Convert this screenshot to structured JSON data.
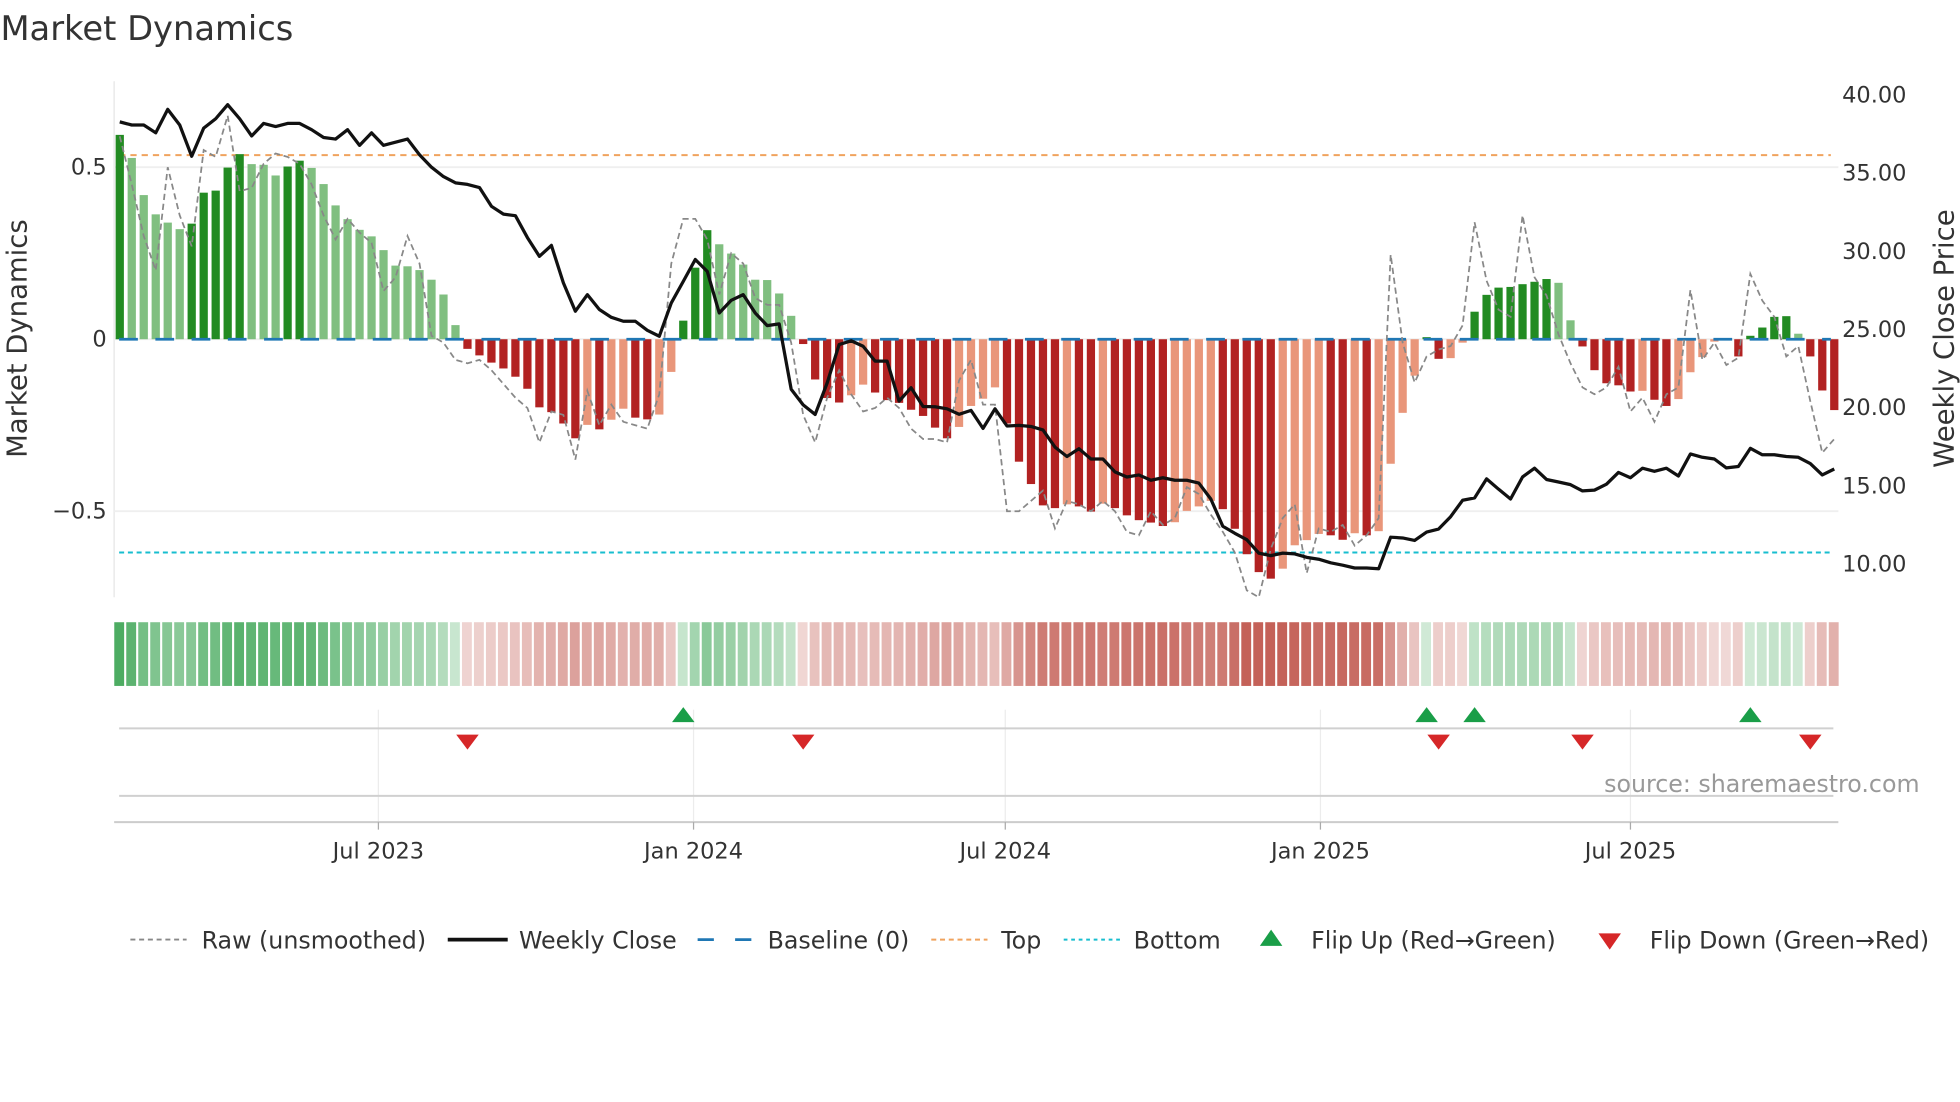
{
  "chart_data": {
    "type": "bar",
    "title": "Market Dynamics",
    "ylabel": "Market Dynamics",
    "y2label": "Weekly Close Price",
    "source": "source: sharemaestro.com",
    "ylim": [
      -0.75,
      0.75
    ],
    "y2lim": [
      7.8,
      40.8
    ],
    "start_date": "2023-01-31",
    "step_days": 7,
    "y_ticks": [
      {
        "value": 0.5,
        "label": "0.5"
      },
      {
        "value": 0,
        "label": "0"
      },
      {
        "value": -0.5,
        "label": "−0.5"
      }
    ],
    "y2_ticks": [
      {
        "value": 40,
        "label": "40.00"
      },
      {
        "value": 35,
        "label": "35.00"
      },
      {
        "value": 30,
        "label": "30.00"
      },
      {
        "value": 25,
        "label": "25.00"
      },
      {
        "value": 20,
        "label": "20.00"
      },
      {
        "value": 15,
        "label": "15.00"
      },
      {
        "value": 10,
        "label": "10.00"
      }
    ],
    "x_ticks": [
      {
        "date": "2023-07-01",
        "label": "Jul 2023"
      },
      {
        "date": "2024-01-01",
        "label": "Jan 2024"
      },
      {
        "date": "2024-07-01",
        "label": "Jul 2024"
      },
      {
        "date": "2025-01-01",
        "label": "Jan 2025"
      },
      {
        "date": "2025-07-01",
        "label": "Jul 2025"
      }
    ],
    "top_level": 0.535,
    "bottom_level": -0.62,
    "baseline": 0,
    "momentum": [
      0.594,
      0.527,
      0.419,
      0.363,
      0.339,
      0.32,
      0.336,
      0.426,
      0.432,
      0.499,
      0.538,
      0.509,
      0.507,
      0.476,
      0.502,
      0.519,
      0.498,
      0.451,
      0.389,
      0.349,
      0.318,
      0.299,
      0.259,
      0.214,
      0.212,
      0.201,
      0.173,
      0.13,
      0.041,
      -0.028,
      -0.047,
      -0.068,
      -0.085,
      -0.109,
      -0.144,
      -0.198,
      -0.212,
      -0.245,
      -0.288,
      -0.249,
      -0.262,
      -0.234,
      -0.202,
      -0.228,
      -0.233,
      -0.219,
      -0.095,
      0.054,
      0.208,
      0.317,
      0.276,
      0.249,
      0.217,
      0.173,
      0.172,
      0.133,
      0.068,
      -0.014,
      -0.117,
      -0.171,
      -0.184,
      -0.163,
      -0.132,
      -0.155,
      -0.177,
      -0.185,
      -0.205,
      -0.223,
      -0.257,
      -0.288,
      -0.255,
      -0.194,
      -0.173,
      -0.14,
      -0.245,
      -0.356,
      -0.421,
      -0.483,
      -0.491,
      -0.48,
      -0.486,
      -0.501,
      -0.478,
      -0.491,
      -0.512,
      -0.526,
      -0.533,
      -0.543,
      -0.532,
      -0.499,
      -0.486,
      -0.47,
      -0.494,
      -0.551,
      -0.625,
      -0.677,
      -0.696,
      -0.667,
      -0.599,
      -0.584,
      -0.566,
      -0.57,
      -0.583,
      -0.564,
      -0.57,
      -0.558,
      -0.362,
      -0.214,
      -0.106,
      0.006,
      -0.057,
      -0.055,
      -0.01,
      0.08,
      0.129,
      0.15,
      0.152,
      0.16,
      0.167,
      0.175,
      0.164,
      0.055,
      -0.021,
      -0.09,
      -0.128,
      -0.134,
      -0.152,
      -0.15,
      -0.176,
      -0.194,
      -0.174,
      -0.096,
      -0.052,
      -0.007,
      -0.002,
      -0.05,
      0.01,
      0.034,
      0.065,
      0.067,
      0.016,
      -0.05,
      -0.149,
      -0.206
    ],
    "raw": [
      0.59,
      0.45,
      0.3,
      0.2,
      0.5,
      0.36,
      0.27,
      0.55,
      0.53,
      0.65,
      0.43,
      0.44,
      0.51,
      0.54,
      0.53,
      0.51,
      0.45,
      0.36,
      0.29,
      0.35,
      0.31,
      0.28,
      0.14,
      0.18,
      0.3,
      0.22,
      0.01,
      -0.01,
      -0.06,
      -0.07,
      -0.06,
      -0.09,
      -0.13,
      -0.17,
      -0.2,
      -0.3,
      -0.21,
      -0.22,
      -0.35,
      -0.15,
      -0.25,
      -0.19,
      -0.24,
      -0.25,
      -0.26,
      -0.16,
      0.22,
      0.35,
      0.35,
      0.29,
      0.13,
      0.25,
      0.22,
      0.12,
      0.1,
      0.1,
      -0.01,
      -0.22,
      -0.3,
      -0.17,
      -0.09,
      -0.16,
      -0.21,
      -0.2,
      -0.17,
      -0.2,
      -0.26,
      -0.29,
      -0.29,
      -0.3,
      -0.12,
      -0.06,
      -0.19,
      -0.19,
      -0.5,
      -0.5,
      -0.47,
      -0.44,
      -0.55,
      -0.47,
      -0.48,
      -0.5,
      -0.47,
      -0.5,
      -0.56,
      -0.57,
      -0.5,
      -0.54,
      -0.52,
      -0.43,
      -0.45,
      -0.51,
      -0.56,
      -0.62,
      -0.73,
      -0.75,
      -0.61,
      -0.52,
      -0.48,
      -0.68,
      -0.55,
      -0.56,
      -0.54,
      -0.6,
      -0.57,
      -0.52,
      0.246,
      -0.01,
      -0.126,
      -0.05,
      -0.03,
      -0.02,
      0.04,
      0.34,
      0.17,
      0.086,
      0.065,
      0.36,
      0.18,
      0.127,
      0.014,
      -0.07,
      -0.14,
      -0.16,
      -0.14,
      -0.08,
      -0.21,
      -0.17,
      -0.24,
      -0.16,
      -0.14,
      0.143,
      -0.06,
      -0.01,
      -0.075,
      -0.054,
      0.19,
      0.112,
      0.065,
      -0.05,
      -0.02,
      -0.18,
      -0.33,
      -0.29
    ],
    "weekly_close": [
      38.2,
      38.0,
      38.0,
      37.5,
      39.0,
      38.0,
      36.0,
      37.8,
      38.4,
      39.3,
      38.4,
      37.3,
      38.1,
      37.9,
      38.1,
      38.1,
      37.7,
      37.2,
      37.1,
      37.7,
      36.7,
      37.5,
      36.7,
      36.9,
      37.1,
      36.1,
      35.3,
      34.7,
      34.3,
      34.2,
      34.0,
      32.8,
      32.3,
      32.2,
      30.8,
      29.6,
      30.3,
      27.9,
      26.09,
      27.15,
      26.2,
      25.7,
      25.45,
      25.45,
      24.87,
      24.49,
      26.62,
      28.0,
      29.4,
      28.64,
      25.98,
      26.79,
      27.15,
      25.98,
      25.17,
      25.28,
      21.1,
      20.1,
      19.49,
      21.5,
      23.96,
      24.2,
      23.85,
      22.9,
      22.9,
      20.34,
      21.2,
      20.0,
      19.98,
      19.85,
      19.5,
      19.75,
      18.6,
      19.85,
      18.75,
      18.79,
      18.72,
      18.5,
      17.4,
      16.8,
      17.3,
      16.64,
      16.64,
      15.82,
      15.49,
      15.62,
      15.28,
      15.44,
      15.28,
      15.28,
      15.1,
      14.08,
      12.34,
      11.89,
      11.48,
      10.62,
      10.46,
      10.62,
      10.57,
      10.35,
      10.23,
      10.0,
      9.85,
      9.67,
      9.67,
      9.62,
      11.64,
      11.59,
      11.43,
      11.97,
      12.16,
      12.95,
      14.0,
      14.15,
      15.37,
      14.71,
      14.08,
      15.49,
      16.05,
      15.33,
      15.17,
      15.0,
      14.6,
      14.65,
      15.03,
      15.78,
      15.44,
      16.05,
      15.85,
      16.05,
      15.55,
      16.96,
      16.75,
      16.64,
      16.07,
      16.16,
      17.32,
      16.91,
      16.91,
      16.8,
      16.75,
      16.35,
      15.62,
      16.0
    ],
    "flip_up_weeks": [
      48,
      110,
      114,
      137
    ],
    "flip_down_weeks": [
      30,
      58,
      111,
      123,
      142
    ],
    "colors": {
      "up_strong": "#228b22",
      "up_weak": "#80bf80",
      "down_strong": "#b22222",
      "down_weak": "#e9967a",
      "heat_green": "#32a04b",
      "heat_red": "#be5046",
      "raw": "#888888",
      "close": "#111111",
      "baseline": "#1f77b4",
      "top": "#f0a35e",
      "bottom": "#17becf",
      "flip_up": "#1a9e48",
      "flip_down": "#d62728"
    },
    "legend": [
      {
        "key": "raw",
        "label": "Raw (unsmoothed)"
      },
      {
        "key": "close",
        "label": "Weekly Close"
      },
      {
        "key": "baseline",
        "label": "Baseline (0)"
      },
      {
        "key": "top",
        "label": "Top"
      },
      {
        "key": "bottom",
        "label": "Bottom"
      },
      {
        "key": "flip_up",
        "label": "Flip Up (Red→Green)"
      },
      {
        "key": "flip_down",
        "label": "Flip Down (Green→Red)"
      }
    ],
    "legend_placement": "bottom"
  }
}
